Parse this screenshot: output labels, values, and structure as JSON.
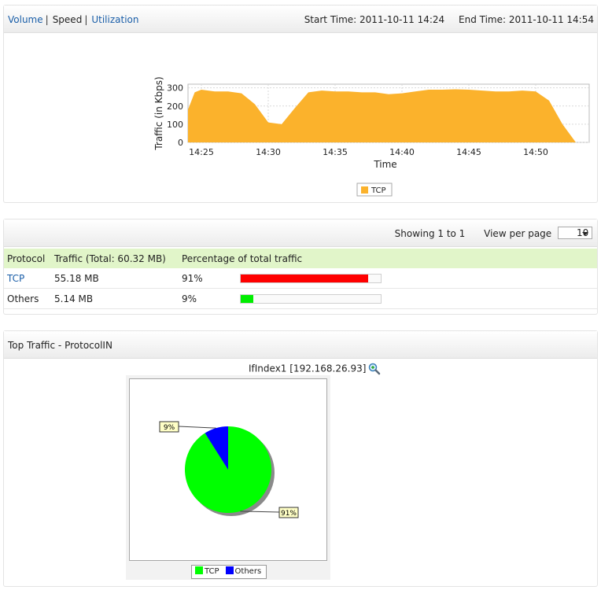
{
  "tabs": {
    "volume": "Volume",
    "speed": "Speed",
    "utilization": "Utilization",
    "separator": "|"
  },
  "time_range": {
    "start": "Start Time: 2011-10-11 14:24",
    "end": "End Time: 2011-10-11 14:54"
  },
  "traffic_chart": {
    "legend_label": "TCP",
    "color": "#fbb22c"
  },
  "chart_data": [
    {
      "type": "area",
      "title": "",
      "xlabel": "Time",
      "ylabel": "Traffic (in Kbps)",
      "x_ticks": [
        "14:25",
        "14:30",
        "14:35",
        "14:40",
        "14:45",
        "14:50"
      ],
      "y_ticks": [
        0,
        100,
        200,
        300
      ],
      "ylim": [
        0,
        320
      ],
      "grid": true,
      "legend": "bottom-center",
      "series": [
        {
          "name": "TCP",
          "x": [
            "14:24",
            "14:24.5",
            "14:25",
            "14:26",
            "14:27",
            "14:28",
            "14:29",
            "14:30",
            "14:31",
            "14:32",
            "14:33",
            "14:34",
            "14:35",
            "14:36",
            "14:37",
            "14:38",
            "14:39",
            "14:40",
            "14:41",
            "14:42",
            "14:43",
            "14:44",
            "14:45",
            "14:46",
            "14:47",
            "14:48",
            "14:49",
            "14:50",
            "14:51",
            "14:52",
            "14:53"
          ],
          "values": [
            180,
            275,
            290,
            280,
            280,
            270,
            210,
            110,
            100,
            190,
            275,
            285,
            280,
            280,
            275,
            275,
            265,
            270,
            280,
            290,
            290,
            292,
            290,
            285,
            280,
            280,
            285,
            280,
            230,
            100,
            0
          ]
        }
      ]
    },
    {
      "type": "pie",
      "title": "IfIndex1 [192.168.26.93]",
      "categories": [
        "TCP",
        "Others"
      ],
      "values": [
        91,
        9
      ],
      "labels": [
        "91%",
        "9%"
      ],
      "colors": [
        "#00ff00",
        "#0000ff"
      ],
      "legend": "bottom-center"
    }
  ],
  "pager": {
    "showing": "Showing 1 to 1",
    "view_per_page_label": "View per page",
    "view_per_page_value": "10"
  },
  "table": {
    "headers": [
      "Protocol",
      "Traffic (Total: 60.32 MB)",
      "Percentage of total traffic"
    ],
    "rows": [
      {
        "protocol": "TCP",
        "traffic": "55.18 MB",
        "percent": "91%",
        "fraction": 0.91,
        "color": "#ff0000"
      },
      {
        "protocol": "Others",
        "traffic": "5.14 MB",
        "percent": "9%",
        "fraction": 0.09,
        "color": "#00ee00"
      }
    ]
  },
  "top_traffic": {
    "title": "Top Traffic - ProtocolIN",
    "pie_title": "IfIndex1 [192.168.26.93]"
  },
  "icons": {
    "zoom": "zoom-icon",
    "dropdown": "chevron-down-icon"
  }
}
